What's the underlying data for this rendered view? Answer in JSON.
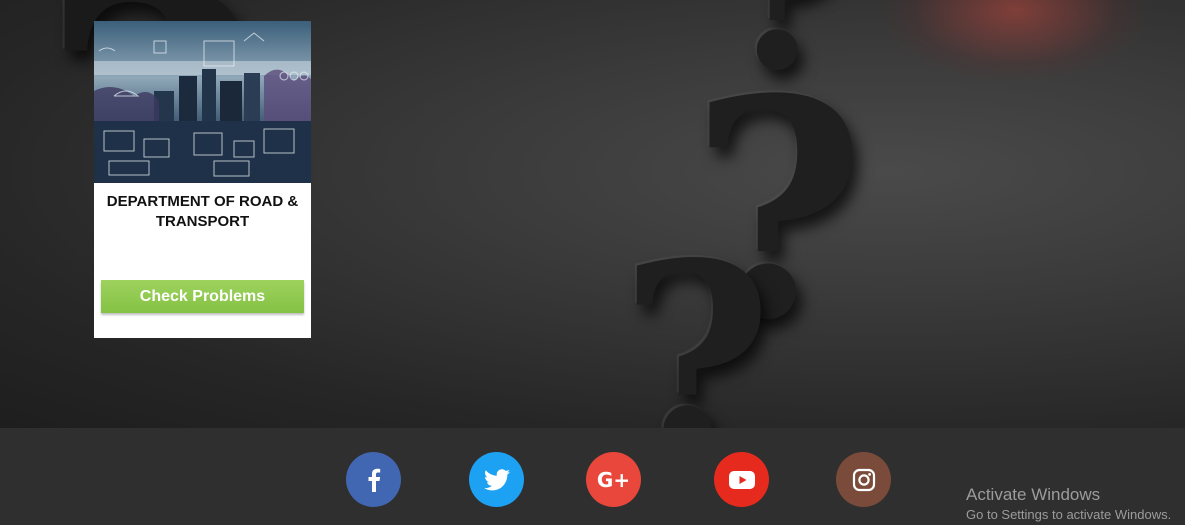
{
  "card": {
    "title": "DEPARTMENT OF ROAD & TRANSPORT",
    "button_label": "Check Problems",
    "image_icon": "sketch-city-illustration"
  },
  "social": [
    {
      "name": "facebook",
      "icon": "facebook-icon",
      "glyph": "f",
      "color": "#4267b2"
    },
    {
      "name": "twitter",
      "icon": "twitter-icon",
      "glyph": "",
      "color": "#1da1f2"
    },
    {
      "name": "google-plus",
      "icon": "google-plus-icon",
      "glyph": "G+",
      "color": "#e9473b"
    },
    {
      "name": "youtube",
      "icon": "youtube-icon",
      "glyph": "",
      "color": "#e62b1e"
    },
    {
      "name": "instagram",
      "icon": "instagram-icon",
      "glyph": "",
      "color": "#7a4b3a"
    }
  ],
  "watermark": {
    "line1": "Activate Windows",
    "line2": "Go to Settings to activate Windows."
  },
  "colors": {
    "button_green": "#8cc84b",
    "footer_bg": "#2f2f2f"
  }
}
